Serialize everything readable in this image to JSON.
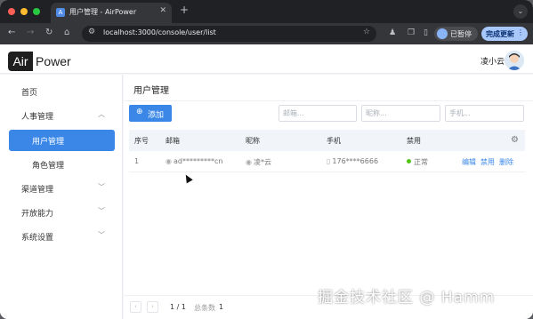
{
  "browser": {
    "tab_title": "用户管理 - AirPower",
    "tab_favicon": "A",
    "url": "localhost:3000/console/user/list",
    "profile_label": "已暂停",
    "update_label": "完成更新",
    "icons": [
      "back-arrow-icon",
      "forward-arrow-icon",
      "reload-icon",
      "home-icon",
      "site-info-icon",
      "bookmark-star-icon",
      "extension-icon",
      "side-panel-icon"
    ],
    "traffic_lights": [
      "#ff5f57",
      "#febc2e",
      "#28c840"
    ]
  },
  "app": {
    "logo_left": "Air",
    "logo_right": "Power",
    "username": "凌小云",
    "accent": "#3a87e8"
  },
  "sidebar": {
    "items": [
      {
        "label": "首页",
        "chevron": ""
      },
      {
        "label": "人事管理",
        "chevron": "︿"
      },
      {
        "label": "用户管理",
        "chevron": ""
      },
      {
        "label": "角色管理",
        "chevron": ""
      },
      {
        "label": "渠道管理",
        "chevron": "﹀"
      },
      {
        "label": "开放能力",
        "chevron": "﹀"
      },
      {
        "label": "系统设置",
        "chevron": "﹀"
      }
    ]
  },
  "page": {
    "title": "用户管理",
    "add_label": "添加",
    "filters": {
      "email_placeholder": "邮箱...",
      "nickname_placeholder": "昵称...",
      "phone_placeholder": "手机..."
    },
    "columns": [
      "序号",
      "邮箱",
      "昵称",
      "手机",
      "禁用"
    ],
    "rows": [
      {
        "index": "1",
        "email": "ad*********cn",
        "nickname": "凌*云",
        "phone": "176****6666",
        "status": "正常",
        "actions": [
          "编辑",
          "禁用",
          "删除"
        ]
      }
    ],
    "pager": {
      "prev": "‹",
      "next": "›",
      "page": "1 / 1",
      "total_label": "总条数",
      "total_value": "1"
    }
  },
  "watermark": "掘金技术社区 @ Hamm"
}
